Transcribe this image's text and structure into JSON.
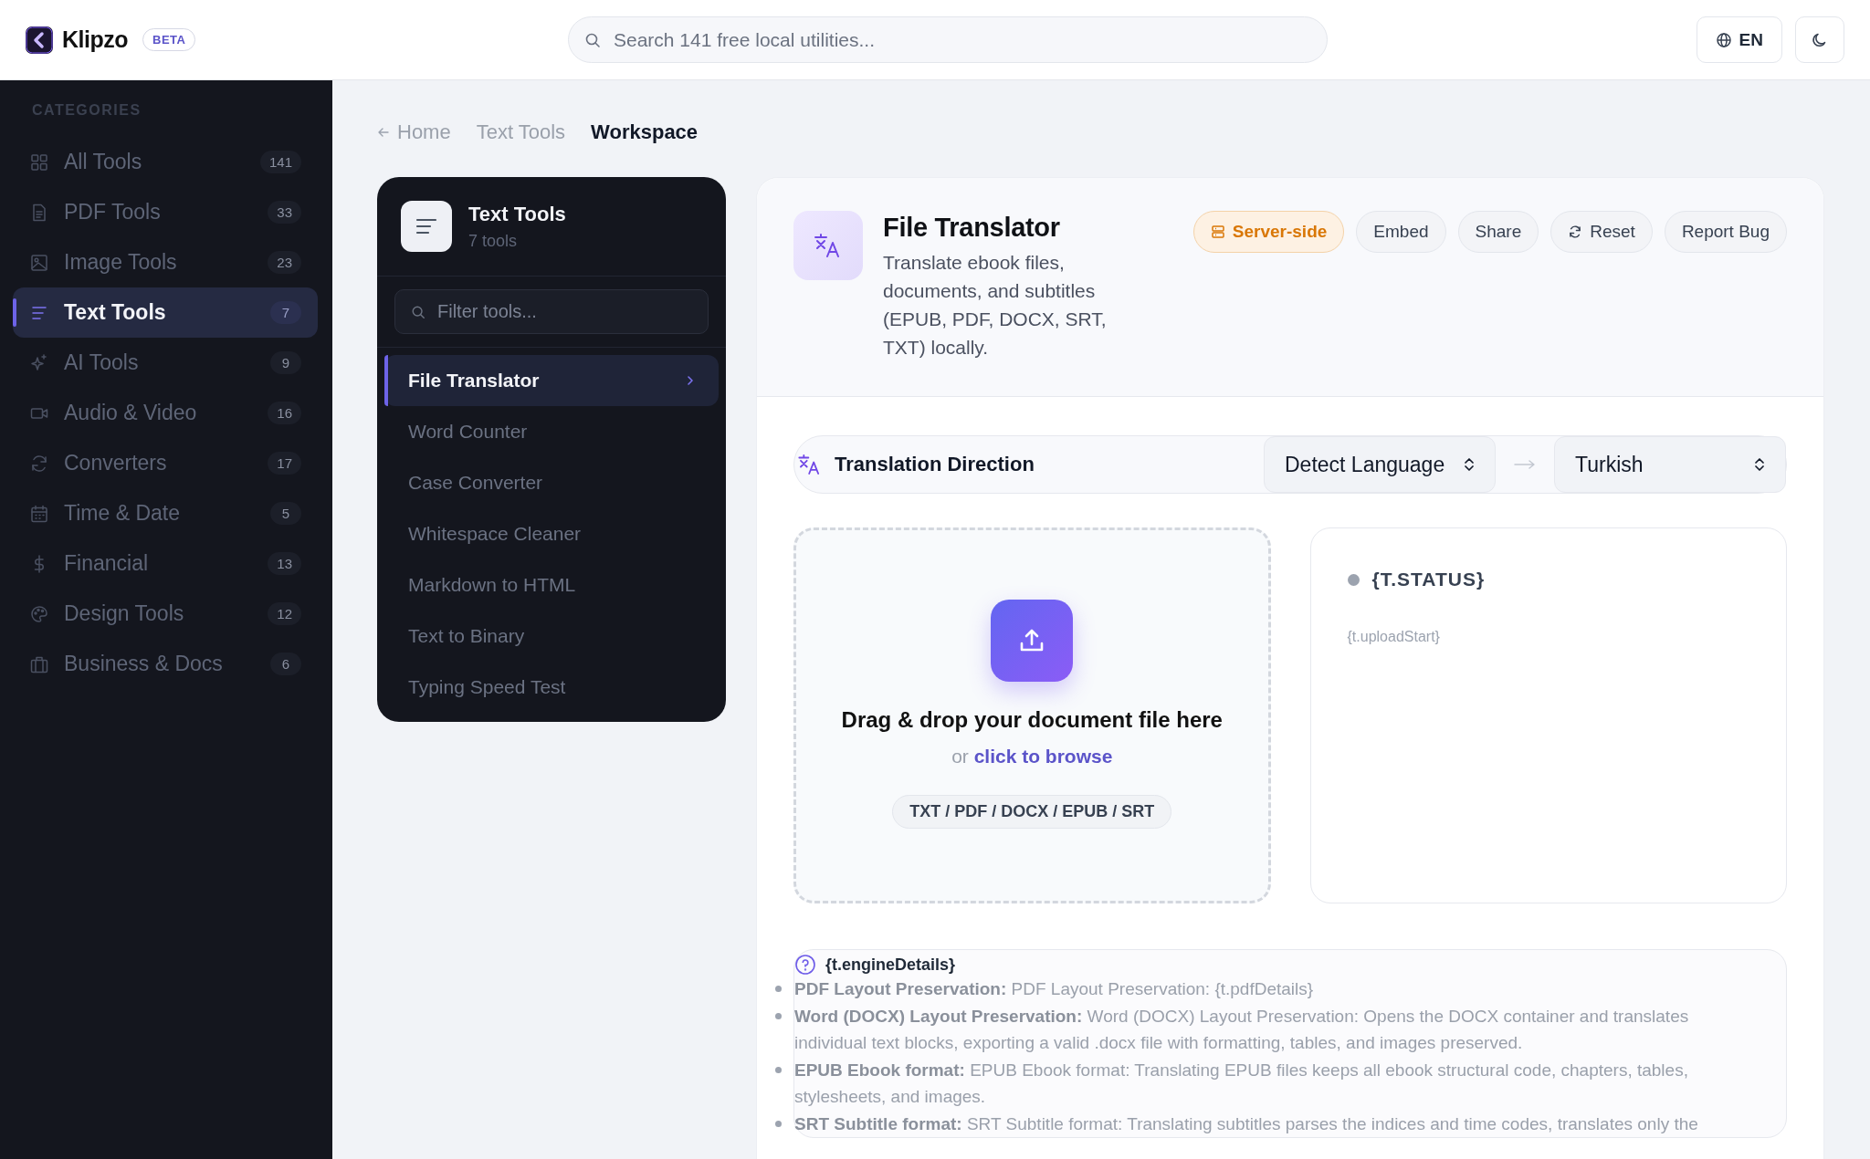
{
  "brand": {
    "name": "Klipzo",
    "badge": "BETA"
  },
  "search": {
    "placeholder": "Search 141 free local utilities..."
  },
  "language_button": "EN",
  "sidebar": {
    "heading": "CATEGORIES",
    "items": [
      {
        "label": "All Tools",
        "count": "141",
        "selected": false
      },
      {
        "label": "PDF Tools",
        "count": "33",
        "selected": false
      },
      {
        "label": "Image Tools",
        "count": "23",
        "selected": false
      },
      {
        "label": "Text Tools",
        "count": "7",
        "selected": true
      },
      {
        "label": "AI Tools",
        "count": "9",
        "selected": false
      },
      {
        "label": "Audio & Video",
        "count": "16",
        "selected": false
      },
      {
        "label": "Converters",
        "count": "17",
        "selected": false
      },
      {
        "label": "Time & Date",
        "count": "5",
        "selected": false
      },
      {
        "label": "Financial",
        "count": "13",
        "selected": false
      },
      {
        "label": "Design Tools",
        "count": "12",
        "selected": false
      },
      {
        "label": "Business & Docs",
        "count": "6",
        "selected": false
      }
    ]
  },
  "breadcrumb": [
    {
      "label": "Home",
      "kind": "back"
    },
    {
      "label": "Text Tools",
      "kind": "link"
    },
    {
      "label": "Workspace",
      "kind": "current"
    }
  ],
  "tool_panel": {
    "title": "Text Tools",
    "subtitle": "7 tools",
    "filter_placeholder": "Filter tools...",
    "items": [
      {
        "label": "File Translator",
        "selected": true
      },
      {
        "label": "Word Counter",
        "selected": false
      },
      {
        "label": "Case Converter",
        "selected": false
      },
      {
        "label": "Whitespace Cleaner",
        "selected": false
      },
      {
        "label": "Markdown to HTML",
        "selected": false
      },
      {
        "label": "Text to Binary",
        "selected": false
      },
      {
        "label": "Typing Speed Test",
        "selected": false
      }
    ]
  },
  "tool": {
    "title": "File Translator",
    "description": "Translate ebook files, documents, and subtitles (EPUB, PDF, DOCX, SRT, TXT) locally.",
    "actions": [
      {
        "label": "Server-side",
        "kind": "server"
      },
      {
        "label": "Embed",
        "kind": "plain"
      },
      {
        "label": "Share",
        "kind": "plain"
      },
      {
        "label": "Reset",
        "kind": "reset"
      },
      {
        "label": "Report Bug",
        "kind": "plain"
      }
    ]
  },
  "direction": {
    "label": "Translation Direction",
    "source": "Detect Language",
    "target": "Turkish"
  },
  "upload": {
    "title": "Drag & drop your document file here",
    "prefix": "or",
    "link": "click to browse",
    "formats": "TXT / PDF / DOCX / EPUB / SRT"
  },
  "status": {
    "title": "{T.STATUS}",
    "message": "{t.uploadStart}"
  },
  "details": {
    "title": "{t.engineDetails}",
    "items": [
      "**PDF Layout Preservation:** PDF Layout Preservation: {t.pdfDetails}",
      "**Word (DOCX) Layout Preservation:** Word (DOCX) Layout Preservation: Opens the DOCX container and translates individual text blocks, exporting a valid .docx file with formatting, tables, and images preserved.",
      "**EPUB Ebook format:** EPUB Ebook format: Translating EPUB files keeps all ebook structural code, chapters, tables, stylesheets, and images.",
      "**SRT Subtitle format:** SRT Subtitle format: Translating subtitles parses the indices and time codes, translates only the"
    ]
  }
}
